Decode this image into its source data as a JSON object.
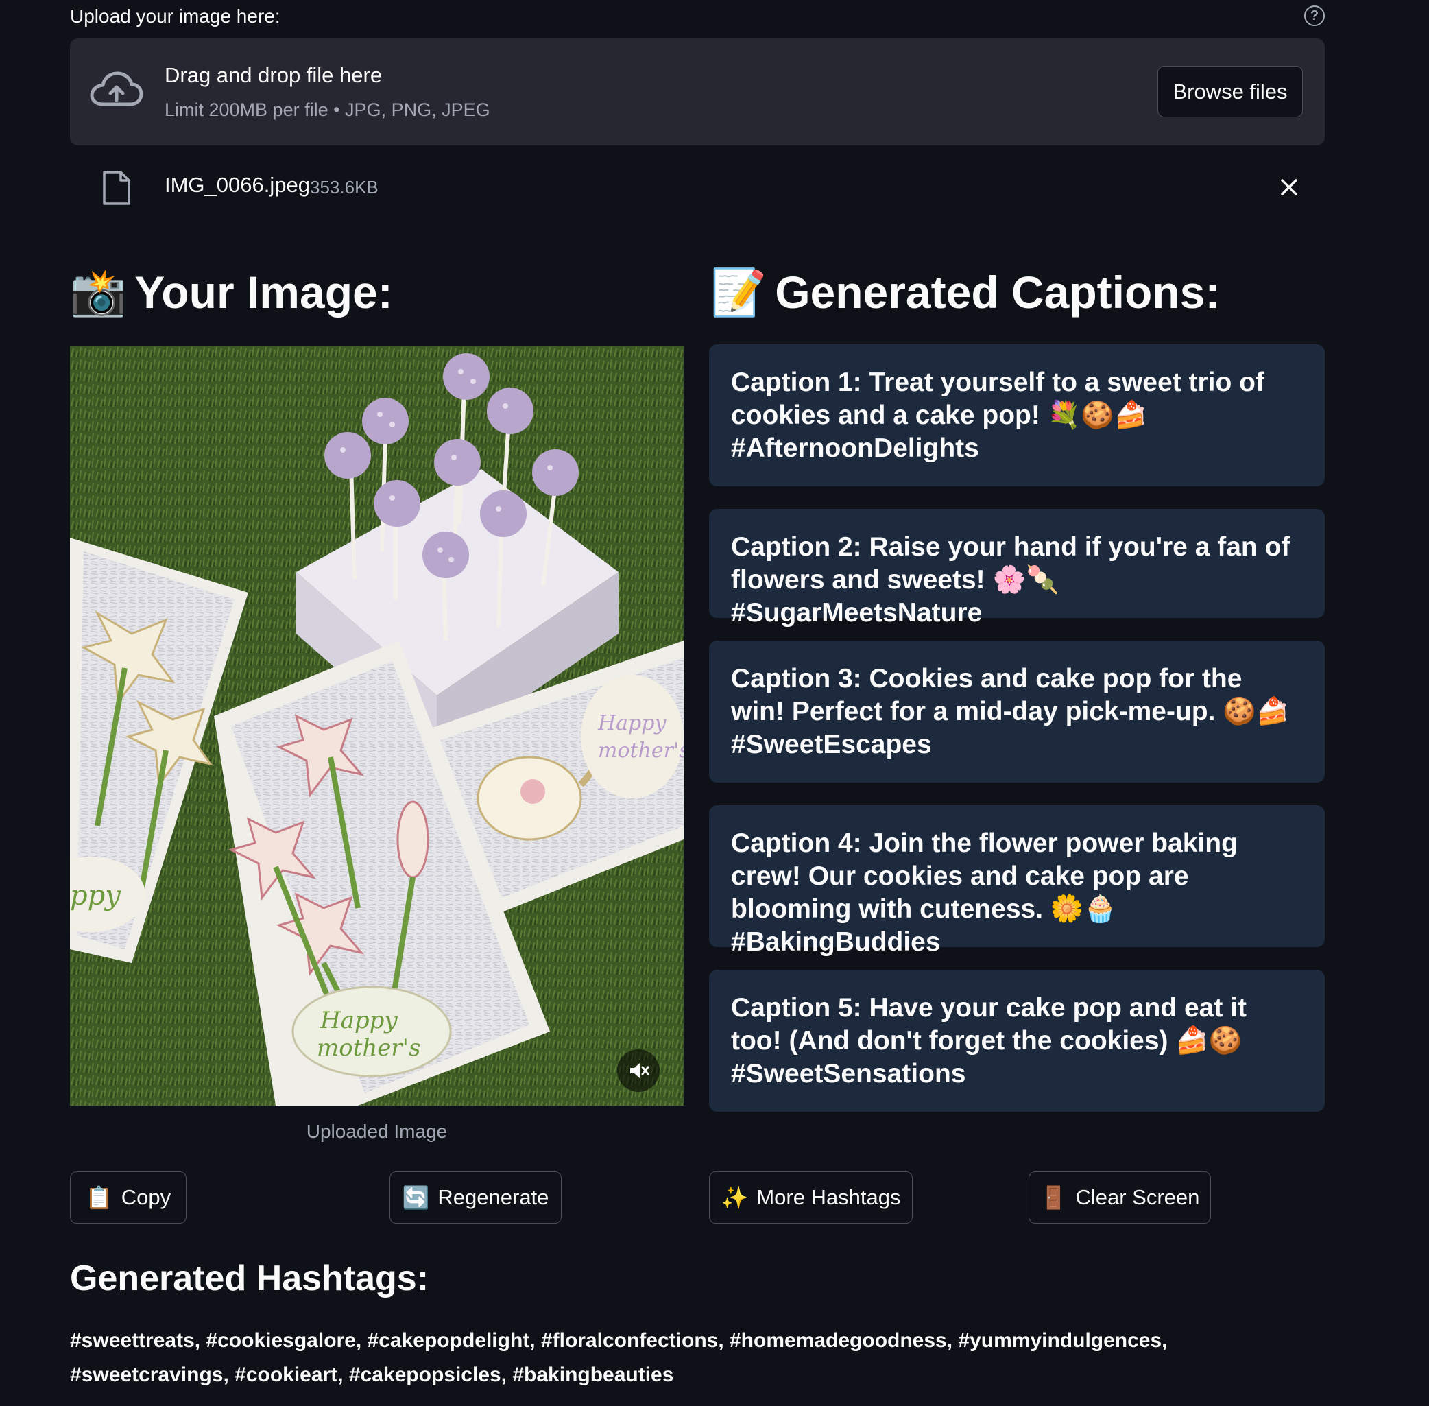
{
  "uploader": {
    "label": "Upload your image here:",
    "drop_title": "Drag and drop file here",
    "drop_subtitle": "Limit 200MB per file • JPG, PNG, JPEG",
    "browse_label": "Browse files"
  },
  "file": {
    "name": "IMG_0066.jpeg",
    "size": "353.6KB"
  },
  "image_section": {
    "emoji": "📸",
    "heading": "Your Image:",
    "caption": "Uploaded Image"
  },
  "captions_section": {
    "emoji": "📝",
    "heading": "Generated Captions:",
    "items": [
      "Caption 1: Treat yourself to a sweet trio of cookies and a cake pop! 💐🍪🍰 #AfternoonDelights",
      "Caption 2: Raise your hand if you're a fan of flowers and sweets! 🌸🍡 #SugarMeetsNature",
      "Caption 3: Cookies and cake pop for the win! Perfect for a mid-day pick-me-up. 🍪🍰 #SweetEscapes",
      "Caption 4: Join the flower power baking crew! Our cookies and cake pop are blooming with cuteness. 🌼🧁 #BakingBuddies",
      "Caption 5: Have your cake pop and eat it too! (And don't forget the cookies) 🍰🍪 #SweetSensations"
    ]
  },
  "actions": {
    "copy": {
      "emoji": "📋",
      "label": "Copy"
    },
    "regenerate": {
      "emoji": "🔄",
      "label": "Regenerate"
    },
    "hashtags": {
      "emoji": "✨",
      "label": "More Hashtags"
    },
    "clear": {
      "emoji": "🚪",
      "label": "Clear Screen"
    }
  },
  "hashtags_section": {
    "heading": "Generated Hashtags:",
    "text": "#sweettreats, #cookiesgalore, #cakepopdelight, #floralconfections, #homemadegoodness, #yummyindulgences, #sweetcravings, #cookieart, #cakepopsicles, #bakingbeauties"
  },
  "colors": {
    "background": "#0e1117",
    "card": "#1d2a3e",
    "dropzone": "#262730",
    "muted_text": "#a3a8b4"
  }
}
